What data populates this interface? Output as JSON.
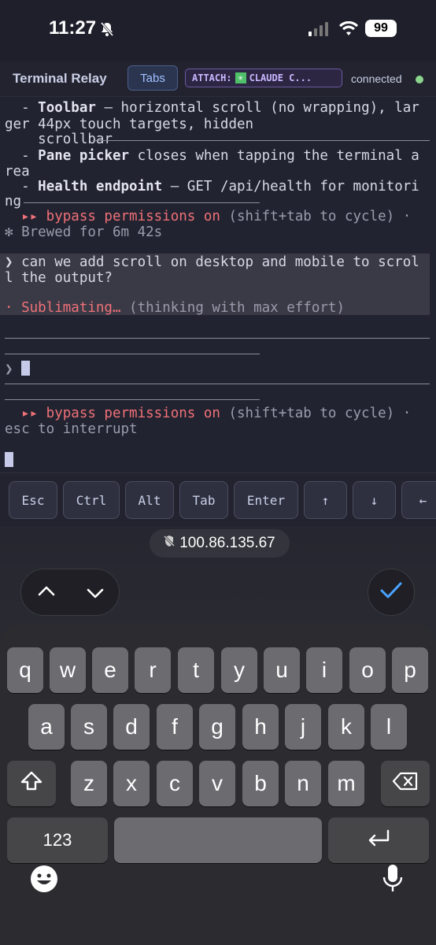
{
  "status": {
    "time": "11:27",
    "battery": "99"
  },
  "header": {
    "title": "Terminal Relay",
    "tabs_label": "Tabs",
    "attach_prefix": "ATTACH:",
    "attach_session": "CLAUDE C...",
    "connection": "connected"
  },
  "terminal": {
    "l1a": "  - ",
    "l1b": "Toolbar",
    "l1c": " — horizontal scroll (no wrapping), lar",
    "l2": "ger 44px touch targets, hidden",
    "l3": "    scrollbar",
    "l4a": "  - ",
    "l4b": "Pane picker",
    "l4c": " closes when tapping the terminal a",
    "l5": "rea",
    "l6a": "  - ",
    "l6b": "Health endpoint",
    "l6c": " — GET /api/health for monitori",
    "l7": "ng",
    "l8a": "  ▸▸ bypass permissions on",
    "l8b": " (shift+tab to cycle) ·",
    "l9": "✻ Brewed for 6m 42s",
    "l10": "❯ can we add scroll on desktop and mobile to scrol",
    "l11": "l the output?",
    "l12a": "· Sublimating…",
    "l12b": " (thinking with max effort)",
    "prompt": "❯ ",
    "l14a": "  ▸▸ bypass permissions on",
    "l14b": " (shift+tab to cycle) ·",
    "l15": "esc to interrupt"
  },
  "keybar": [
    "Esc",
    "Ctrl",
    "Alt",
    "Tab",
    "Enter",
    "↑",
    "↓",
    "←"
  ],
  "browser": {
    "url": "100.86.135.67"
  },
  "keyboard": {
    "row1": [
      "q",
      "w",
      "e",
      "r",
      "t",
      "y",
      "u",
      "i",
      "o",
      "p"
    ],
    "row2": [
      "a",
      "s",
      "d",
      "f",
      "g",
      "h",
      "j",
      "k",
      "l"
    ],
    "row3": [
      "z",
      "x",
      "c",
      "v",
      "b",
      "n",
      "m"
    ],
    "numbers": "123"
  }
}
